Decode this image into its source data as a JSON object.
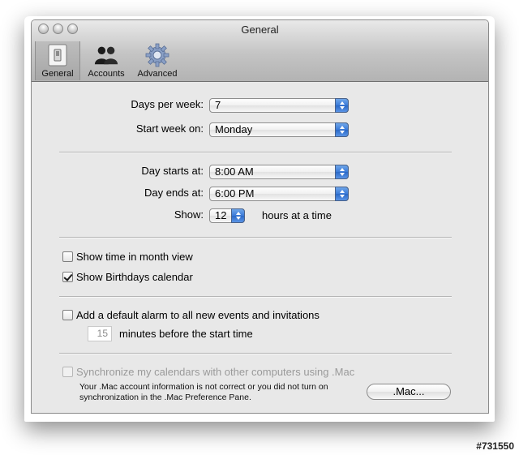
{
  "window": {
    "title": "General"
  },
  "toolbar": {
    "items": [
      {
        "label": "General",
        "icon": "light-switch-icon",
        "selected": true
      },
      {
        "label": "Accounts",
        "icon": "people-icon"
      },
      {
        "label": "Advanced",
        "icon": "gear-icon"
      }
    ]
  },
  "week": {
    "days_label": "Days per week:",
    "days_value": "7",
    "start_label": "Start week on:",
    "start_value": "Monday"
  },
  "day": {
    "starts_label": "Day starts at:",
    "starts_value": "8:00 AM",
    "ends_label": "Day ends at:",
    "ends_value": "6:00 PM",
    "show_label": "Show:",
    "show_value": "12",
    "show_suffix": "hours at a time"
  },
  "options": {
    "month_view": {
      "label": "Show time in month view",
      "checked": false
    },
    "birthdays": {
      "label": "Show Birthdays calendar",
      "checked": true
    }
  },
  "alarm": {
    "label": "Add a default alarm to all new events and invitations",
    "checked": false,
    "minutes_value": "15",
    "minutes_suffix": "minutes before the start time"
  },
  "sync": {
    "label": "Synchronize my calendars with other computers using .Mac",
    "enabled": false,
    "note_line1": "Your .Mac account information is not correct or you did not turn on",
    "note_line2": "synchronization in the .Mac Preference Pane.",
    "button_label": ".Mac..."
  },
  "watermark": "#731550",
  "colors": {
    "accent": "#3a7ad8",
    "window_bg": "#e8e8e8"
  }
}
